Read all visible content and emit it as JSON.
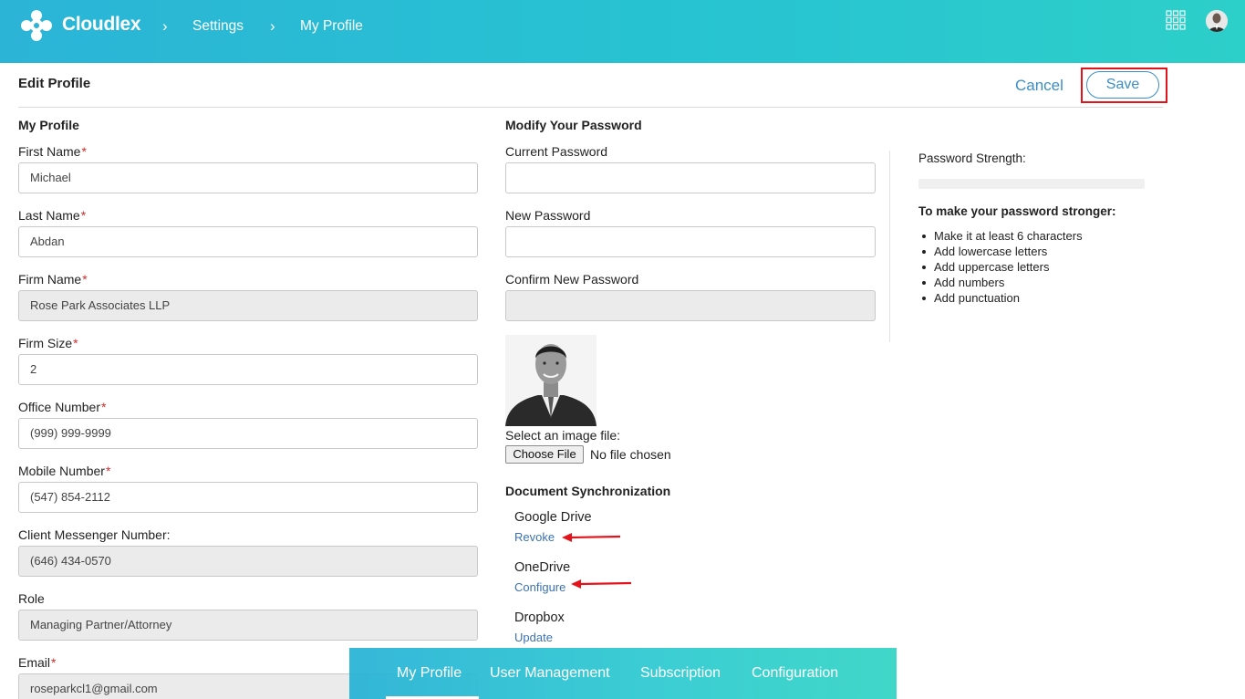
{
  "header": {
    "brand": "Cloudlex",
    "breadcrumb": [
      "Settings",
      "My Profile"
    ],
    "apps_icon": "grid-icon",
    "avatar_icon": "user-avatar"
  },
  "page": {
    "title": "Edit Profile",
    "cancel_label": "Cancel",
    "save_label": "Save"
  },
  "profile": {
    "section_title": "My Profile",
    "fields": [
      {
        "label": "First Name",
        "required": "*",
        "value": "Michael"
      },
      {
        "label": "Last Name",
        "required": "*",
        "value": "Abdan"
      },
      {
        "label": "Firm Name",
        "required": "*",
        "value": "Rose Park Associates LLP"
      },
      {
        "label": "Firm Size",
        "required": "*",
        "value": "2"
      },
      {
        "label": "Office Number",
        "required": "*",
        "value": "(999) 999-9999"
      },
      {
        "label": "Mobile Number",
        "required": "*",
        "value": "(547) 854-2112"
      },
      {
        "label": "Client Messenger Number:",
        "required": "",
        "value": "(646) 434-0570"
      },
      {
        "label": "Role",
        "required": "",
        "value": "Managing Partner/Attorney"
      },
      {
        "label": "Email",
        "required": "*",
        "value": "roseparkcl1@gmail.com"
      }
    ]
  },
  "password": {
    "section_title": "Modify Your Password",
    "current_label": "Current Password",
    "new_label": "New Password",
    "confirm_label": "Confirm New Password",
    "strength_label": "Password Strength:",
    "tips_title": "To make your password stronger:",
    "tips": [
      "Make it at least 6 characters",
      "Add lowercase letters",
      "Add uppercase letters",
      "Add numbers",
      "Add punctuation"
    ]
  },
  "photo": {
    "select_label": "Select an image file:",
    "choose_button": "Choose File",
    "no_file_text": "No file chosen"
  },
  "sync": {
    "section_title": "Document Synchronization",
    "services": [
      {
        "name": "Google Drive",
        "action": "Revoke"
      },
      {
        "name": "OneDrive",
        "action": "Configure"
      },
      {
        "name": "Dropbox",
        "action": "Update"
      }
    ],
    "accent_arrow_color": "#e3131c"
  },
  "bottom_tabs": [
    "My Profile",
    "User Management",
    "Subscription",
    "Configuration"
  ],
  "colors": {
    "header_gradient_start": "#2bb4d6",
    "header_gradient_end": "#2dcfc9",
    "link_blue": "#3b8ec5",
    "required_red": "#d42b2b",
    "highlight_red": "#e3131c"
  }
}
